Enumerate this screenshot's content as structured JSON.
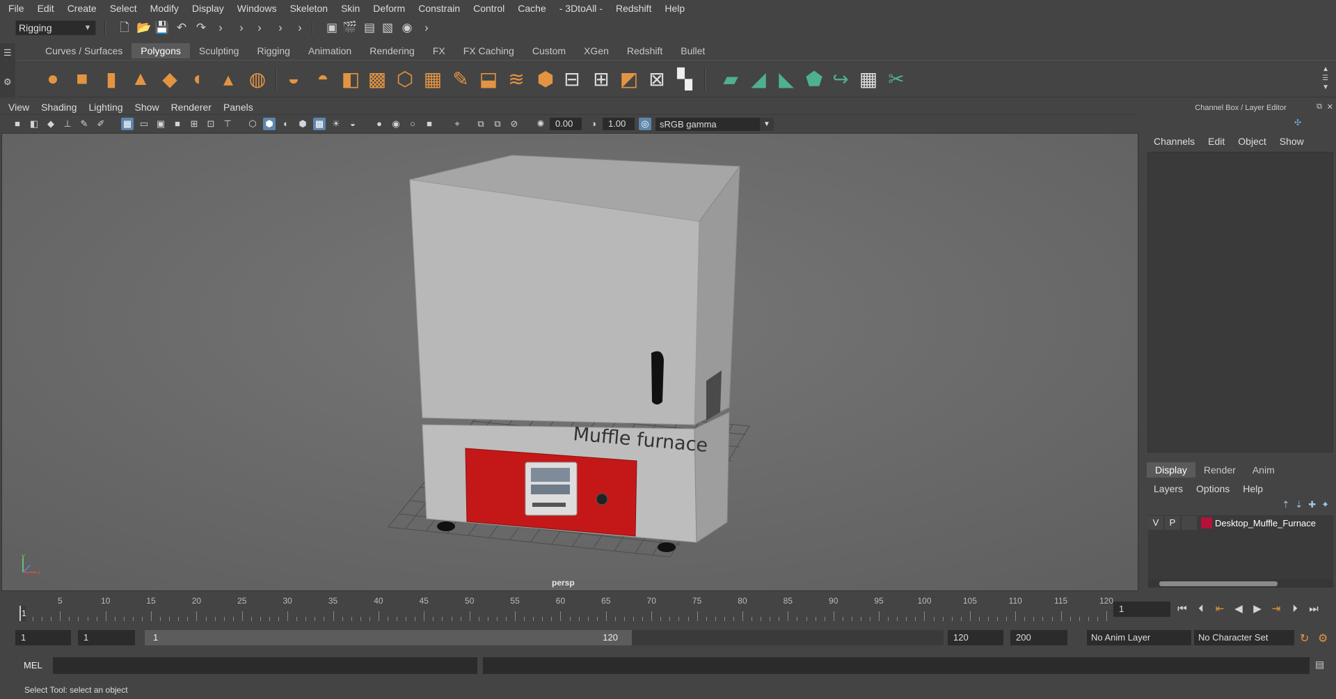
{
  "menubar": {
    "items": [
      "File",
      "Edit",
      "Create",
      "Select",
      "Modify",
      "Display",
      "Windows",
      "Skeleton",
      "Skin",
      "Deform",
      "Constrain",
      "Control",
      "Cache",
      "- 3DtoAll -",
      "Redshift",
      "Help"
    ]
  },
  "statusline": {
    "menuset": "Rigging"
  },
  "shelf": {
    "tabs": [
      "Curves / Surfaces",
      "Polygons",
      "Sculpting",
      "Rigging",
      "Animation",
      "Rendering",
      "FX",
      "FX Caching",
      "Custom",
      "XGen",
      "Redshift",
      "Bullet"
    ],
    "active_tab": "Polygons"
  },
  "viewport": {
    "menu": [
      "View",
      "Shading",
      "Lighting",
      "Show",
      "Renderer",
      "Panels"
    ],
    "exposure": "0.00",
    "gamma": "1.00",
    "color_space": "sRGB gamma",
    "camera_label": "persp",
    "model_text": "Muffle furnace"
  },
  "channel_box": {
    "title": "Channel Box / Layer Editor",
    "tabs": [
      "Channels",
      "Edit",
      "Object",
      "Show"
    ]
  },
  "layer_editor": {
    "tabs": [
      "Display",
      "Render",
      "Anim"
    ],
    "active_tab": "Display",
    "menu": [
      "Layers",
      "Options",
      "Help"
    ],
    "layers": [
      {
        "visible": "V",
        "playback": "P",
        "name": "Desktop_Muffle_Furnace",
        "color": "#b3123a"
      }
    ]
  },
  "timeslider": {
    "ticks": [
      "5",
      "10",
      "15",
      "20",
      "25",
      "30",
      "35",
      "40",
      "45",
      "50",
      "55",
      "60",
      "65",
      "70",
      "75",
      "80",
      "85",
      "90",
      "95",
      "100",
      "105",
      "110",
      "115",
      "120"
    ],
    "current_frame": "1",
    "current_frame_field": "1"
  },
  "range": {
    "start": "1",
    "anim_start": "1",
    "range_start_label": "1",
    "range_end_label": "120",
    "playback_end": "120",
    "anim_end": "200",
    "anim_layer": "No Anim Layer",
    "character_set": "No Character Set"
  },
  "command": {
    "label": "MEL"
  },
  "helpline": {
    "text": "Select Tool: select an object"
  }
}
